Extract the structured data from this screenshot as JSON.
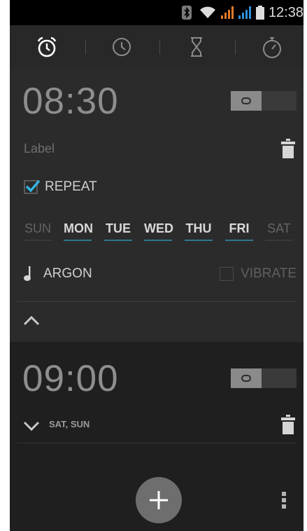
{
  "status_bar": {
    "time": "12:38",
    "icons": [
      "bluetooth-icon",
      "wifi-icon",
      "signal-sim1-icon",
      "signal-sim2-icon",
      "battery-icon"
    ]
  },
  "tabs": [
    {
      "name": "alarm",
      "icon": "alarm-clock-icon",
      "selected": true
    },
    {
      "name": "clock",
      "icon": "clock-icon",
      "selected": false
    },
    {
      "name": "timer",
      "icon": "hourglass-icon",
      "selected": false
    },
    {
      "name": "stopwatch",
      "icon": "stopwatch-icon",
      "selected": false
    }
  ],
  "alarms": [
    {
      "time": "08:30",
      "enabled": false,
      "label_placeholder": "Label",
      "repeat_label": "REPEAT",
      "repeat_checked": true,
      "days": [
        {
          "label": "SUN",
          "selected": false
        },
        {
          "label": "MON",
          "selected": true
        },
        {
          "label": "TUE",
          "selected": true
        },
        {
          "label": "WED",
          "selected": true
        },
        {
          "label": "THU",
          "selected": true
        },
        {
          "label": "FRI",
          "selected": true
        },
        {
          "label": "SAT",
          "selected": false
        }
      ],
      "ringtone": "ARGON",
      "vibrate_label": "VIBRATE",
      "vibrate_checked": false
    },
    {
      "time": "09:00",
      "enabled": false,
      "days_summary": "SAT, SUN"
    }
  ],
  "colors": {
    "accent": "#33b5e5",
    "background": "#1f1f1f",
    "expanded_card": "#2b2b2b",
    "time_text": "#8e8e8e"
  }
}
